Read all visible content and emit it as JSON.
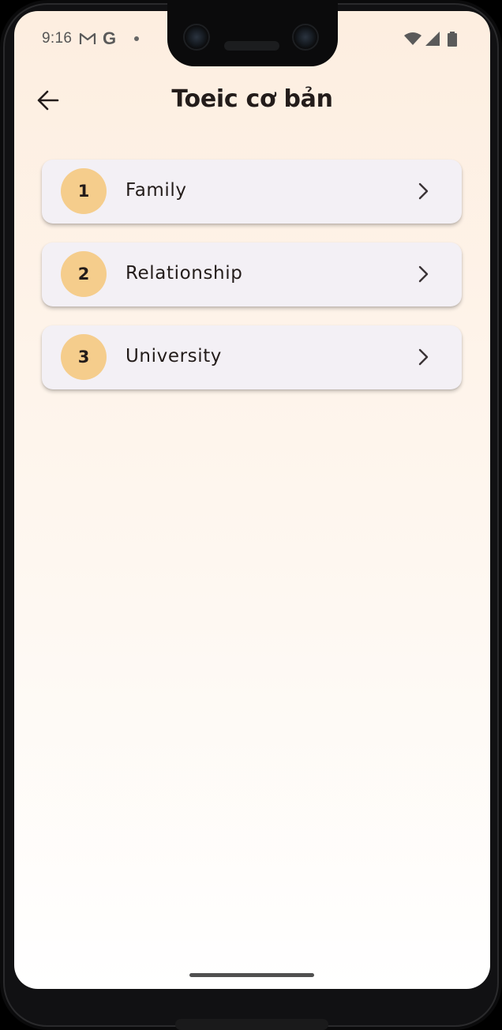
{
  "status_bar": {
    "time": "9:16",
    "icons": [
      "gmail-icon",
      "google-icon",
      "notification-dot-icon",
      "wifi-icon",
      "cell-signal-icon",
      "battery-icon"
    ],
    "google_glyph": "G"
  },
  "app_bar": {
    "title": "Toeic cơ bản",
    "back_icon": "arrow-back-icon"
  },
  "topics": [
    {
      "number": "1",
      "label": "Family"
    },
    {
      "number": "2",
      "label": "Relationship"
    },
    {
      "number": "3",
      "label": "University"
    }
  ],
  "colors": {
    "badge": "#f5cd8c",
    "card": "#f3f0f5",
    "background_top": "#fdeee0",
    "background_bottom": "#ffffff",
    "text": "#231c1a"
  }
}
